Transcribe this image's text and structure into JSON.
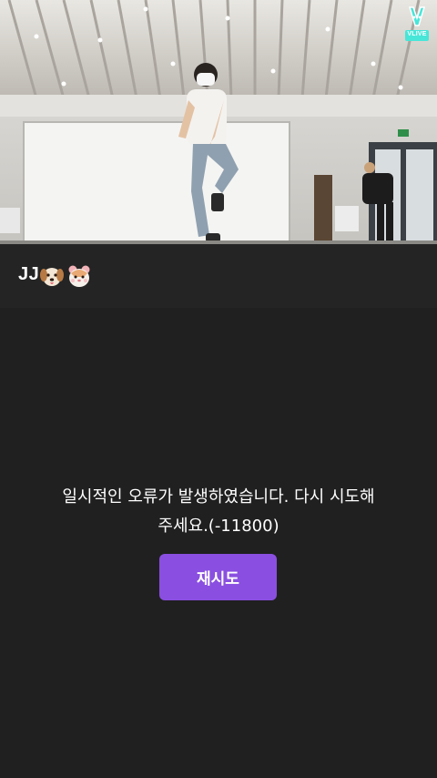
{
  "player": {
    "logo_text": "VLIVE"
  },
  "video_title": {
    "text": "JJ",
    "emoji_1": "puppy-face",
    "emoji_2": "hamster-face"
  },
  "error": {
    "message_line_1": "일시적인 오류가 발생하였습니다. 다시 시도해",
    "message_line_2": "주세요.(-11800)",
    "retry_label": "재시도"
  },
  "colors": {
    "background": "#202020",
    "title_bar": "#242424",
    "retry_button": "#8a4fe0",
    "logo_accent": "#47e6d8"
  }
}
